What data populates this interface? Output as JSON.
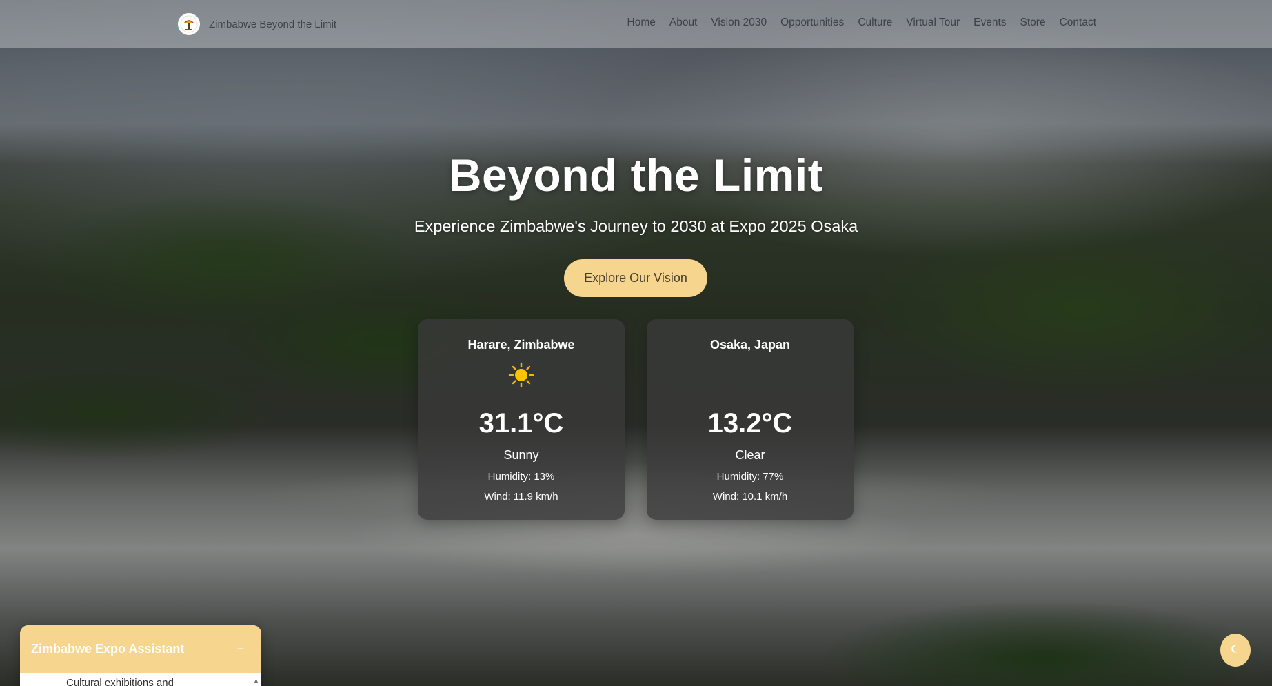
{
  "brand": {
    "name": "Zimbabwe Beyond the Limit",
    "logo_icon": "zimbabwe-tree-logo"
  },
  "nav": {
    "items": [
      {
        "label": "Home"
      },
      {
        "label": "About"
      },
      {
        "label": "Vision 2030"
      },
      {
        "label": "Opportunities"
      },
      {
        "label": "Culture"
      },
      {
        "label": "Virtual Tour"
      },
      {
        "label": "Events"
      },
      {
        "label": "Store"
      },
      {
        "label": "Contact"
      }
    ]
  },
  "hero": {
    "title": "Beyond the Limit",
    "subtitle": "Experience Zimbabwe's Journey to 2030 at Expo 2025 Osaka",
    "cta_label": "Explore Our Vision",
    "background": "victoria-falls-aerial-photo"
  },
  "weather": [
    {
      "city": "Harare, Zimbabwe",
      "icon": "sun-icon",
      "temp": "31.1°C",
      "condition": "Sunny",
      "humidity": "Humidity: 13%",
      "wind": "Wind: 11.9 km/h"
    },
    {
      "city": "Osaka, Japan",
      "icon": "moon-icon",
      "temp": "13.2°C",
      "condition": "Clear",
      "humidity": "Humidity: 77%",
      "wind": "Wind: 10.1 km/h"
    }
  ],
  "chat": {
    "title": "Zimbabwe Expo Assistant",
    "minimize_label": "−",
    "message_preview": "Cultural exhibitions and"
  },
  "theme_toggle": {
    "icon": "moon-icon"
  },
  "colors": {
    "accent": "#f6d58e",
    "card_bg": "#3a3a3a",
    "nav_text": "#3c4148"
  }
}
